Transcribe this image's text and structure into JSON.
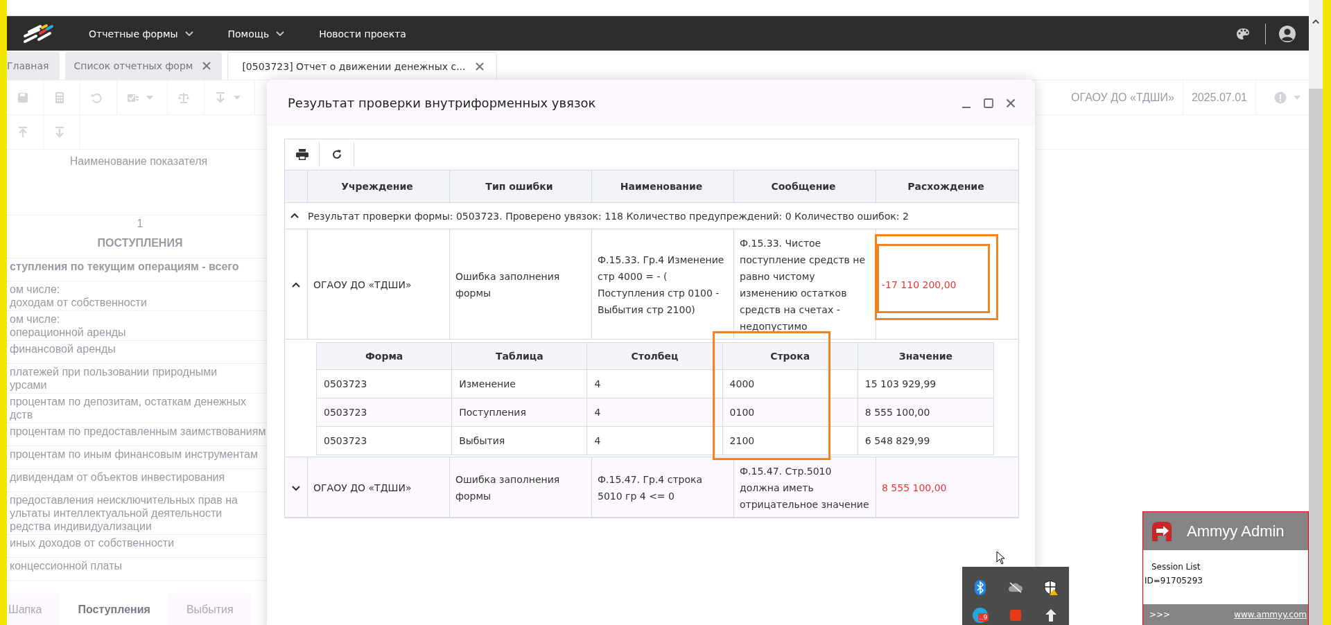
{
  "header": {
    "menu": [
      {
        "label": "Отчетные формы",
        "dropdown": true
      },
      {
        "label": "Помощь",
        "dropdown": true
      },
      {
        "label": "Новости проекта",
        "dropdown": false
      }
    ]
  },
  "tabs": [
    {
      "label": "Главная",
      "selected": false,
      "closable": false
    },
    {
      "label": "Список отчетных форм",
      "selected": false,
      "closable": true
    },
    {
      "label": "[0503723] Отчет о движении денежных с...",
      "selected": true,
      "closable": true
    }
  ],
  "toolbar": {
    "organization": "ОГАОУ ДО «ТДШИ»",
    "date": "2025.07.01"
  },
  "sheet": {
    "column_header": "Наименование показателя",
    "rows": [
      {
        "kind": "number",
        "lines": [
          "1"
        ]
      },
      {
        "kind": "section",
        "lines": [
          "ПОСТУПЛЕНИЯ"
        ]
      },
      {
        "kind": "total",
        "lines": [
          "ступления по текущим операциям - всего"
        ]
      },
      {
        "kind": "item",
        "lines": [
          "ом числе:",
          "доходам от собственности"
        ]
      },
      {
        "kind": "item",
        "lines": [
          "ом числе:",
          "операционной аренды"
        ]
      },
      {
        "kind": "item",
        "lines": [
          "финансовой аренды"
        ]
      },
      {
        "kind": "item",
        "lines": [
          "платежей при пользовании природными",
          "урсами"
        ]
      },
      {
        "kind": "item",
        "lines": [
          "процентам по депозитам, остаткам денежных",
          "дств"
        ]
      },
      {
        "kind": "item",
        "lines": [
          "процентам по предоставленным заимствованиям"
        ]
      },
      {
        "kind": "item",
        "lines": [
          "процентам по иным финансовым инструментам"
        ]
      },
      {
        "kind": "item",
        "lines": [
          "дивидендам от объектов инвестирования"
        ]
      },
      {
        "kind": "item",
        "lines": [
          "предоставления неисключительных прав на",
          "ультаты интеллектуальной деятельности",
          "редства индивидуализации"
        ]
      },
      {
        "kind": "item",
        "lines": [
          "иных доходов от собственности"
        ]
      },
      {
        "kind": "item",
        "lines": [
          "концессионной платы"
        ]
      }
    ]
  },
  "bottom_tabs": [
    {
      "label": "Шапка",
      "selected": false
    },
    {
      "label": "Поступления",
      "selected": true
    },
    {
      "label": "Выбытия",
      "selected": false
    }
  ],
  "dialog": {
    "title": "Результат проверки внутриформенных увязок",
    "columns": [
      "Учреждение",
      "Тип ошибки",
      "Наименование",
      "Сообщение",
      "Расхождение"
    ],
    "group": {
      "label": "Результат проверки формы: 0503723. Проверено увязок: 118 Количество предупреждений: 0 Количество ошибок: 2",
      "expanded": true
    },
    "rows": [
      {
        "expanded": true,
        "cells": [
          "ОГАОУ ДО «ТДШИ»",
          "Ошибка заполнения формы",
          "Ф.15.33. Гр.4 Изменение стр 4000 = - ( Поступления стр 0100 - Выбытия стр 2100)",
          "Ф.15.33. Чистое поступление средств не равно чистому изменению остатков средств на счетах - недопустимо"
        ],
        "discrepancy": "-17 110 200,00",
        "details": {
          "columns": [
            "Форма",
            "Таблица",
            "Столбец",
            "Строка",
            "Значение"
          ],
          "rows": [
            [
              "0503723",
              "Изменение",
              "4",
              "4000",
              "15 103 929,99"
            ],
            [
              "0503723",
              "Поступления",
              "4",
              "0100",
              "8 555 100,00"
            ],
            [
              "0503723",
              "Выбытия",
              "4",
              "2100",
              "6 548 829,99"
            ]
          ]
        }
      },
      {
        "expanded": false,
        "cells": [
          "ОГАОУ ДО «ТДШИ»",
          "Ошибка заполнения формы",
          "Ф.15.47. Гр.4 строка 5010 гр 4 <= 0",
          "Ф.15.47. Стр.5010 должна иметь отрицательное значение"
        ],
        "discrepancy": "8 555 100,00"
      }
    ]
  },
  "tray": {
    "badge": "..9"
  },
  "ammyy": {
    "title": "Ammyy Admin",
    "session_label": "Session List",
    "id": "ID=91705293",
    "footer_left": ">>>",
    "link": "www.ammyy.com"
  }
}
